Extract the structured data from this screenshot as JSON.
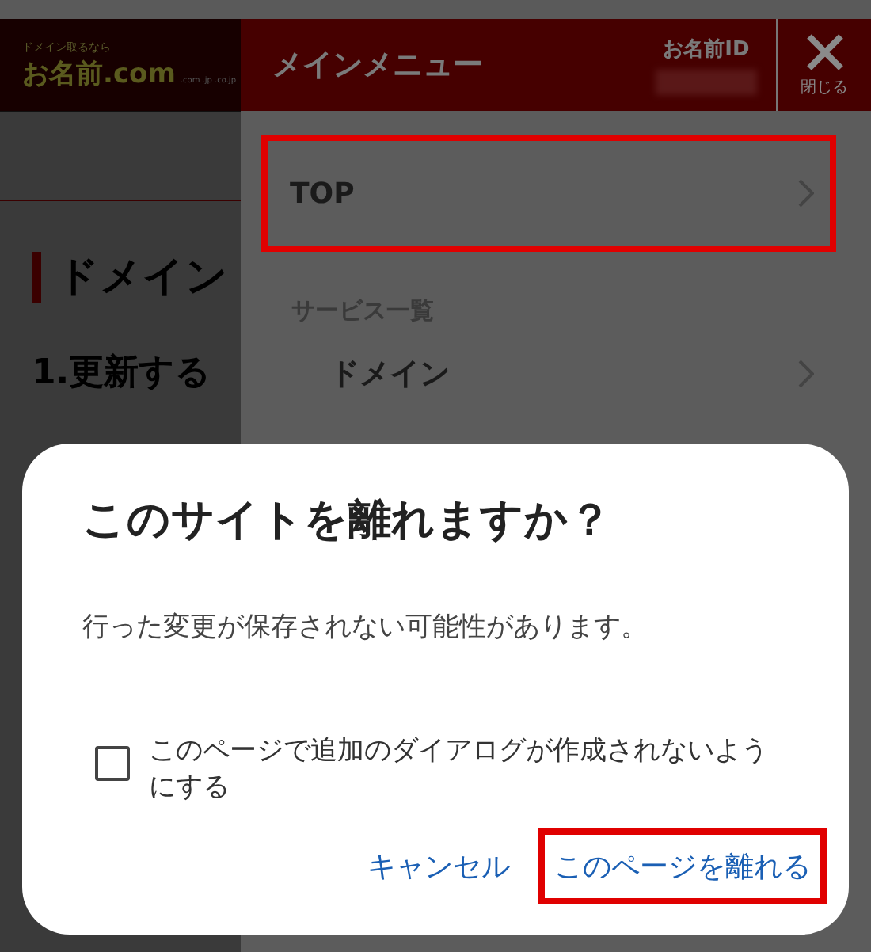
{
  "page": {
    "logo_tagline": "ドメイン取るなら",
    "logo": "お名前.com",
    "logo_domains": ".com .jp .co.jp",
    "heading": "ドメイン",
    "step": "1.更新する"
  },
  "menu": {
    "title": "メインメニュー",
    "id_label": "お名前ID",
    "close_label": "閉じる",
    "items": [
      {
        "kind": "link",
        "label": "TOP",
        "highlighted": true
      },
      {
        "kind": "section",
        "label": "サービス一覧",
        "highlighted": false
      },
      {
        "kind": "sublink",
        "label": "ドメイン",
        "highlighted": false
      }
    ]
  },
  "dialog": {
    "title": "このサイトを離れますか？",
    "message": "行った変更が保存されない可能性があります。",
    "checkbox": {
      "label": "このページで追加のダイアログが作成されないようにする",
      "checked": false
    },
    "buttons": [
      {
        "label": "キャンセル",
        "highlighted": false
      },
      {
        "label": "このページを離れる",
        "highlighted": true
      }
    ]
  }
}
